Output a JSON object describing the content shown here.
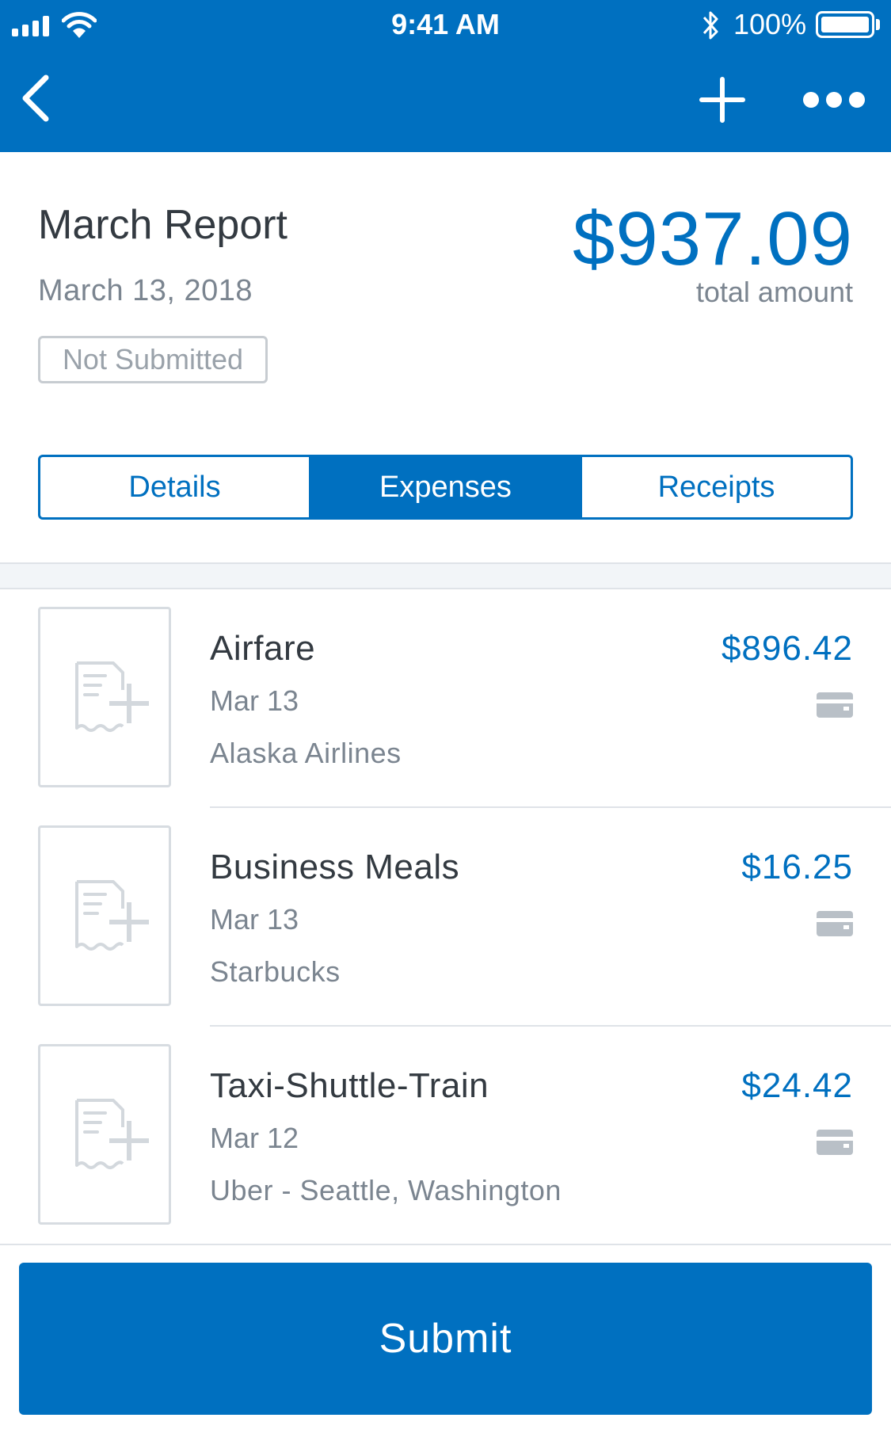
{
  "status_bar": {
    "time": "9:41 AM",
    "battery": "100%"
  },
  "nav": {
    "back_icon": "chevron-left-icon",
    "add_icon": "plus-icon",
    "more_icon": "ellipsis-icon"
  },
  "report": {
    "title": "March Report",
    "date": "March 13, 2018",
    "status": "Not Submitted",
    "total": "$937.09",
    "total_label": "total amount"
  },
  "tabs": [
    {
      "label": "Details",
      "active": false
    },
    {
      "label": "Expenses",
      "active": true
    },
    {
      "label": "Receipts",
      "active": false
    }
  ],
  "expenses": [
    {
      "category": "Airfare",
      "date": "Mar 13",
      "vendor": "Alaska Airlines",
      "amount": "$896.42",
      "payment_icon": "credit-card-icon"
    },
    {
      "category": "Business Meals",
      "date": "Mar 13",
      "vendor": "Starbucks",
      "amount": "$16.25",
      "payment_icon": "credit-card-icon"
    },
    {
      "category": "Taxi-Shuttle-Train",
      "date": "Mar 12",
      "vendor": "Uber - Seattle, Washington",
      "amount": "$24.42",
      "payment_icon": "credit-card-icon"
    }
  ],
  "submit_label": "Submit",
  "colors": {
    "primary": "#0070c0",
    "text": "#333a41",
    "muted": "#7b8590",
    "border": "#dfe3e8"
  }
}
